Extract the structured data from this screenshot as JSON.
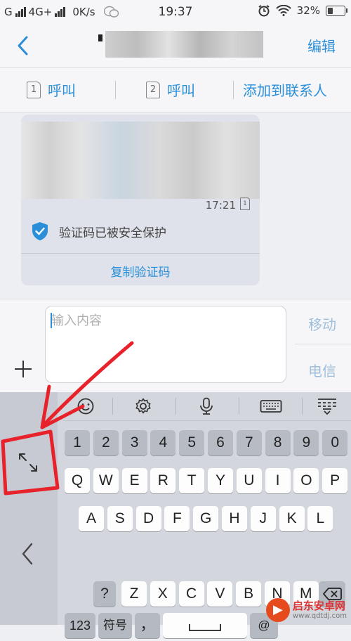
{
  "status_bar": {
    "carrier_1": "G",
    "carrier_2": "4G+",
    "speed": "0K/s",
    "time": "19:37",
    "battery": "32%",
    "battery_fill": 0.32
  },
  "header": {
    "title": "",
    "edit_label": "编辑"
  },
  "actions": [
    {
      "sim": "1",
      "label": "呼叫"
    },
    {
      "sim": "2",
      "label": "呼叫"
    },
    {
      "label": "添加到联系人"
    }
  ],
  "message": {
    "time": "17:21",
    "sim": "1",
    "secure_text": "验证码已被安全保护",
    "copy_label": "复制验证码"
  },
  "compose": {
    "placeholder": "输入内容",
    "send_mobile": "移动",
    "send_telecom": "电信"
  },
  "keyboard": {
    "row_numbers": [
      "1",
      "2",
      "3",
      "4",
      "5",
      "6",
      "7",
      "8",
      "9",
      "0"
    ],
    "row_1": [
      "Q",
      "W",
      "E",
      "R",
      "T",
      "Y",
      "U",
      "I",
      "O",
      "P"
    ],
    "row_2": [
      "A",
      "S",
      "D",
      "F",
      "G",
      "H",
      "J",
      "K",
      "L"
    ],
    "row_3": [
      "?",
      "Z",
      "X",
      "C",
      "V",
      "B",
      "N",
      "M"
    ],
    "bottom": {
      "k123": "123",
      "symbols": "符号",
      "comma": "，",
      "at": "@"
    },
    "toolbar_icons": [
      "emoji-icon",
      "settings-icon",
      "microphone-icon",
      "keyboard-layout-icon",
      "keyboard-hide-icon"
    ]
  },
  "watermark": {
    "name": "启东安卓网",
    "url": "www.qdtdj.com"
  },
  "colors": {
    "accent": "#2a8fd8",
    "annotation": "#e8222a"
  }
}
